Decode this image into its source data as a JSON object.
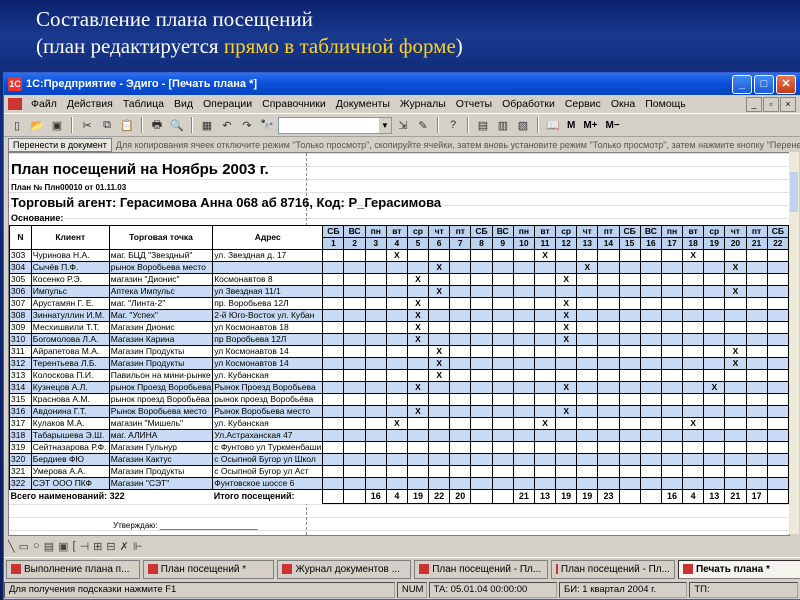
{
  "slide": {
    "line1": "Составление плана посещений",
    "line2_open": "(план редактируется ",
    "line2_hl": "прямо в табличной форме",
    "line2_close": ")"
  },
  "window": {
    "title": "1С:Предприятие - Эдиго - [Печать плана *]",
    "min": "_",
    "max": "□",
    "close": "✕"
  },
  "menu": [
    "Файл",
    "Действия",
    "Таблица",
    "Вид",
    "Операции",
    "Справочники",
    "Документы",
    "Журналы",
    "Отчеты",
    "Обработки",
    "Сервис",
    "Окна",
    "Помощь"
  ],
  "toolbar": {
    "zoom_labels": [
      "M",
      "M+",
      "M−"
    ]
  },
  "hint": {
    "button": "Перенести в документ",
    "text": "Для копирования ячеек отключите режим \"Только просмотр\", скопируйте ячейки, затем вновь установите режим \"Только просмотр\", затем нажмите кнопку \"Перене"
  },
  "doc": {
    "title": "План посещений на Ноябрь 2003 г.",
    "plan_no": "План № Плн00010 от 01.11.03",
    "agent": "Торговый агент: Герасимова  Анна      068 аб 8716, Код: Р_Герасимова",
    "basis": "Основание:",
    "headers": {
      "n": "N",
      "client": "Клиент",
      "outlet": "Торговая точка",
      "address": "Адрес"
    },
    "weekdays": [
      "СБ",
      "ВС",
      "пн",
      "вт",
      "ср",
      "чт",
      "пт",
      "СБ",
      "ВС",
      "пн",
      "вт",
      "ср",
      "чт",
      "пт",
      "СБ",
      "ВС",
      "пн",
      "вт",
      "ср",
      "чт",
      "пт",
      "СБ"
    ],
    "days": [
      "1",
      "2",
      "3",
      "4",
      "5",
      "6",
      "7",
      "8",
      "9",
      "10",
      "11",
      "12",
      "13",
      "14",
      "15",
      "16",
      "17",
      "18",
      "19",
      "20",
      "21",
      "22"
    ],
    "rows": [
      {
        "n": "303",
        "client": "Чуринова Н.А.",
        "outlet": "маг. БЦД \"Звездный\"",
        "address": "ул. Звездная д. 17",
        "marks": [
          4,
          11,
          18
        ]
      },
      {
        "n": "304",
        "client": "Сычёв П.Ф.",
        "outlet": "рынок Воробьева место",
        "address": "",
        "marks": [
          6,
          13,
          20
        ]
      },
      {
        "n": "305",
        "client": "Косенко Р.Э.",
        "outlet": "магазин \"Дионис\"",
        "address": "Космонавтов 8",
        "marks": [
          5,
          12
        ]
      },
      {
        "n": "306",
        "client": "Импульс",
        "outlet": "Аптека Импульс",
        "address": "ул Звездная 11/1",
        "marks": [
          6,
          20
        ]
      },
      {
        "n": "307",
        "client": "Арустамян Г. Е.",
        "outlet": "маг. \"Линта-2\"",
        "address": "пр. Воробьева 12Л",
        "marks": [
          5,
          12
        ]
      },
      {
        "n": "308",
        "client": "Зиннатуллин И.М.",
        "outlet": "Маг. \"Успех\"",
        "address": "2-й Юго-Восток ул. Кубан",
        "marks": [
          5,
          12
        ]
      },
      {
        "n": "309",
        "client": "Месхишвили Т.Т.",
        "outlet": "Магазин Дионис",
        "address": "ул Космонавтов 18",
        "marks": [
          5,
          12
        ]
      },
      {
        "n": "310",
        "client": "Богомолова Л.А.",
        "outlet": "Магазин Карина",
        "address": "пр Воробьева 12Л",
        "marks": [
          5,
          12
        ]
      },
      {
        "n": "311",
        "client": "Айрапетова М.А.",
        "outlet": "Магазин Продукты",
        "address": "ул Космонавтов 14",
        "marks": [
          6,
          20
        ]
      },
      {
        "n": "312",
        "client": "Терентьева Л.Б.",
        "outlet": "Магазин Продукты",
        "address": "ул Космонавтов 14",
        "marks": [
          6,
          20
        ]
      },
      {
        "n": "313",
        "client": "Колоскова П.И.",
        "outlet": "Павильон на мини-рынке",
        "address": "ул. Кубанская",
        "marks": [
          6
        ]
      },
      {
        "n": "314",
        "client": "Кузнецов А.Л.",
        "outlet": "рынок Проезд Воробьева",
        "address": "Рынок Проезд Воробьева",
        "marks": [
          5,
          12,
          19
        ]
      },
      {
        "n": "315",
        "client": "Краснова А.М.",
        "outlet": "рынок проезд Воробьёва",
        "address": "рынок проезд Воробьёва",
        "marks": []
      },
      {
        "n": "316",
        "client": "Авдонина Г.Т.",
        "outlet": "Рынок Воробьева место",
        "address": "Рынок Воробьева место",
        "marks": [
          5,
          12
        ]
      },
      {
        "n": "317",
        "client": "Кулаков М.А.",
        "outlet": "магазин \"Мишель\"",
        "address": "ул. Кубанская",
        "marks": [
          4,
          11,
          18
        ]
      },
      {
        "n": "318",
        "client": "Табарышева Э.Ш.",
        "outlet": "маг. АЛИНА",
        "address": "Ул.Астраханская 47",
        "marks": []
      },
      {
        "n": "319",
        "client": "Сейтназарова Р.Ф.",
        "outlet": "Магазин Гульнур",
        "address": "с Фунтово ул Туркменбаши",
        "marks": []
      },
      {
        "n": "320",
        "client": "Бердиев ФЮ",
        "outlet": "Магазин Кактус",
        "address": "с Осыпной Бугор ул Школ",
        "marks": []
      },
      {
        "n": "321",
        "client": "Умерова А.А.",
        "outlet": "Магазин Продукты",
        "address": "с Осыпной Бугор ул Аст",
        "marks": []
      },
      {
        "n": "322",
        "client": "СЭТ ООО ПКФ",
        "outlet": "Магазин \"СЭТ\"",
        "address": "Фунтовское шоссе 6",
        "marks": []
      }
    ],
    "mark": "X",
    "total_items": "Всего наименований: 322",
    "total_visits_label": "Итого посещений:",
    "totals": [
      "",
      "",
      "16",
      "4",
      "19",
      "22",
      "20",
      "",
      "",
      "21",
      "13",
      "19",
      "19",
      "23",
      "",
      "",
      "16",
      "4",
      "13",
      "21",
      "17",
      ""
    ],
    "approve": "Утверждаю: ______________________"
  },
  "tasks": [
    {
      "label": "Выполнение плана п...",
      "active": false
    },
    {
      "label": "План посещений *",
      "active": false
    },
    {
      "label": "Журнал документов ...",
      "active": false
    },
    {
      "label": "План посещений - Пл...",
      "active": false
    },
    {
      "label": "План посещений - Пл...",
      "active": false
    },
    {
      "label": "Печать плана *",
      "active": true
    }
  ],
  "status": {
    "hint": "Для получения подсказки нажмите F1",
    "num": "NUM",
    "ta": "ТА: 05.01.04  00:00:00",
    "bi": "БИ: 1 квартал 2004 г.",
    "tp": "ТП:"
  },
  "colors": {
    "row_alt": "#c9daf5",
    "header_day": "#bcd3f0",
    "accent": "#ffd21e"
  }
}
